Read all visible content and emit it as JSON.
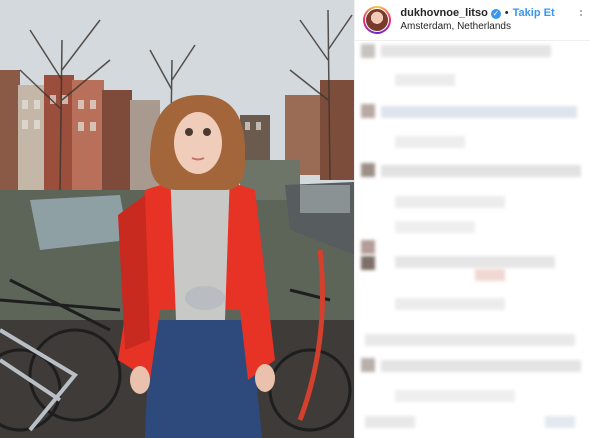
{
  "post": {
    "author": {
      "username": "dukhovnoe_litso",
      "verified": true,
      "separator": "•",
      "follow_label": "Takip Et",
      "location": "Amsterdam, Netherlands"
    }
  },
  "colors": {
    "link_blue": "#3897f0",
    "jacket_red": "#e63325",
    "text_dark": "#262626"
  },
  "icons": {
    "verified": "verified-badge-icon",
    "more": "more-options-icon"
  }
}
